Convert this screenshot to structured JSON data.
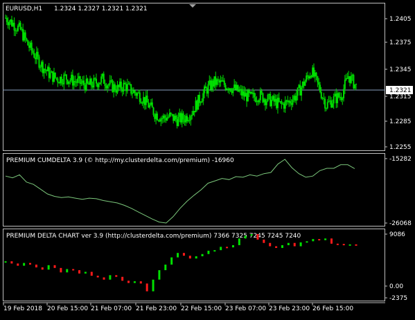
{
  "colors": {
    "background": "#000000",
    "frame": "#c0c0c0",
    "bull": "#00e000",
    "bear": "#ff1a1a",
    "cum_line": "#7cc87c",
    "text": "#ffffff",
    "price_line": "#8aa0c0"
  },
  "panes": {
    "main": {
      "symbol": "EURUSD,H1",
      "ohlc": "1.2324 1.2327 1.2321 1.2321",
      "price_tag": "1.2321",
      "y_ticks": [
        "1.2405",
        "1.2375",
        "1.2345",
        "1.2315",
        "1.2285",
        "1.2255"
      ]
    },
    "cumdelta": {
      "title": "PREMIUM CUMDELTA 3.9 (© http://my.clusterdelta.com/premium) -16960",
      "y_ticks": [
        "-15282",
        "-26068"
      ]
    },
    "delta": {
      "title": "PREMIUM DELTA CHART ver 3.9 (http://clusterdelta.com/premium) 7366 7325 7245 7245 7240",
      "y_ticks": [
        "9086",
        "0.00",
        "-2375"
      ]
    }
  },
  "x_axis": {
    "labels": [
      "19 Feb 2018",
      "20 Feb 15:00",
      "21 Feb 07:00",
      "21 Feb 23:00",
      "22 Feb 15:00",
      "23 Feb 07:00",
      "23 Feb 23:00",
      "26 Feb 15:00"
    ]
  },
  "chart_data": [
    {
      "type": "candlestick",
      "title": "EURUSD,H1",
      "ylim": [
        1.2245,
        1.2415
      ],
      "x": [
        "19 Feb 2018 00:00",
        "19 Feb 2018 03:00",
        "19 Feb 2018 06:00",
        "19 Feb 2018 09:00",
        "19 Feb 2018 12:00",
        "19 Feb 2018 15:00",
        "19 Feb 2018 18:00",
        "19 Feb 2018 21:00",
        "20 Feb 00:00",
        "20 Feb 03:00",
        "20 Feb 06:00",
        "20 Feb 09:00",
        "20 Feb 12:00",
        "20 Feb 15:00",
        "20 Feb 18:00",
        "20 Feb 21:00",
        "21 Feb 00:00",
        "21 Feb 03:00",
        "21 Feb 06:00",
        "21 Feb 09:00",
        "21 Feb 12:00",
        "21 Feb 15:00",
        "21 Feb 18:00",
        "21 Feb 21:00",
        "22 Feb 00:00",
        "22 Feb 03:00",
        "22 Feb 06:00",
        "22 Feb 09:00",
        "22 Feb 12:00",
        "22 Feb 15:00",
        "22 Feb 18:00",
        "22 Feb 21:00",
        "23 Feb 00:00",
        "23 Feb 03:00",
        "23 Feb 06:00",
        "23 Feb 09:00",
        "23 Feb 12:00",
        "23 Feb 15:00",
        "23 Feb 18:00",
        "23 Feb 21:00",
        "26 Feb 00:00",
        "26 Feb 03:00",
        "26 Feb 06:00",
        "26 Feb 09:00",
        "26 Feb 12:00",
        "26 Feb 15:00",
        "26 Feb 18:00",
        "26 Feb 21:00"
      ],
      "close": [
        1.2405,
        1.2398,
        1.239,
        1.2372,
        1.2358,
        1.2345,
        1.2335,
        1.233,
        1.2332,
        1.2328,
        1.2325,
        1.2322,
        1.2325,
        1.233,
        1.2322,
        1.2318,
        1.2322,
        1.2315,
        1.231,
        1.23,
        1.2288,
        1.2282,
        1.2284,
        1.228,
        1.2282,
        1.229,
        1.2305,
        1.2318,
        1.2326,
        1.2324,
        1.2321,
        1.2316,
        1.231,
        1.2307,
        1.231,
        1.2305,
        1.2302,
        1.2298,
        1.2302,
        1.231,
        1.2325,
        1.234,
        1.232,
        1.2298,
        1.2305,
        1.231,
        1.2334,
        1.2321
      ]
    },
    {
      "type": "line",
      "title": "PREMIUM CUMDELTA 3.9 (© http://my.clusterdelta.com/premium) -16960",
      "ylim": [
        -26068,
        -15282
      ],
      "y": [
        -18200,
        -18500,
        -18000,
        -19200,
        -19600,
        -20400,
        -21200,
        -21600,
        -21800,
        -21700,
        -21900,
        -22100,
        -21900,
        -22000,
        -22300,
        -22500,
        -22700,
        -23100,
        -23600,
        -24200,
        -24800,
        -25400,
        -25900,
        -26068,
        -25000,
        -23600,
        -22400,
        -21400,
        -20500,
        -19400,
        -19000,
        -18600,
        -18800,
        -18300,
        -18400,
        -18000,
        -18200,
        -17800,
        -17600,
        -16200,
        -15400,
        -16800,
        -17800,
        -18400,
        -18200,
        -17300,
        -16900,
        -16900,
        -16300,
        -16300,
        -16960
      ]
    },
    {
      "type": "bar",
      "title": "PREMIUM DELTA CHART ver 3.9 (http://clusterdelta.com/premium) 7366 7325 7245 7245 7240",
      "ylim": [
        -2375,
        9086
      ],
      "values": [
        4200,
        3800,
        3400,
        3900,
        3600,
        3100,
        2700,
        3500,
        3000,
        2200,
        2800,
        2600,
        2000,
        2300,
        1600,
        1300,
        900,
        1700,
        1400,
        700,
        300,
        600,
        200,
        -1200,
        900,
        2600,
        3600,
        4900,
        5700,
        5200,
        4700,
        5100,
        5500,
        6100,
        6200,
        6800,
        6700,
        7100,
        8300,
        8800,
        9086,
        8100,
        7500,
        6900,
        6600,
        7100,
        7500,
        6900,
        7600,
        7800,
        8200,
        8000,
        8300,
        7366,
        7325,
        7245,
        7245,
        7240
      ]
    }
  ]
}
